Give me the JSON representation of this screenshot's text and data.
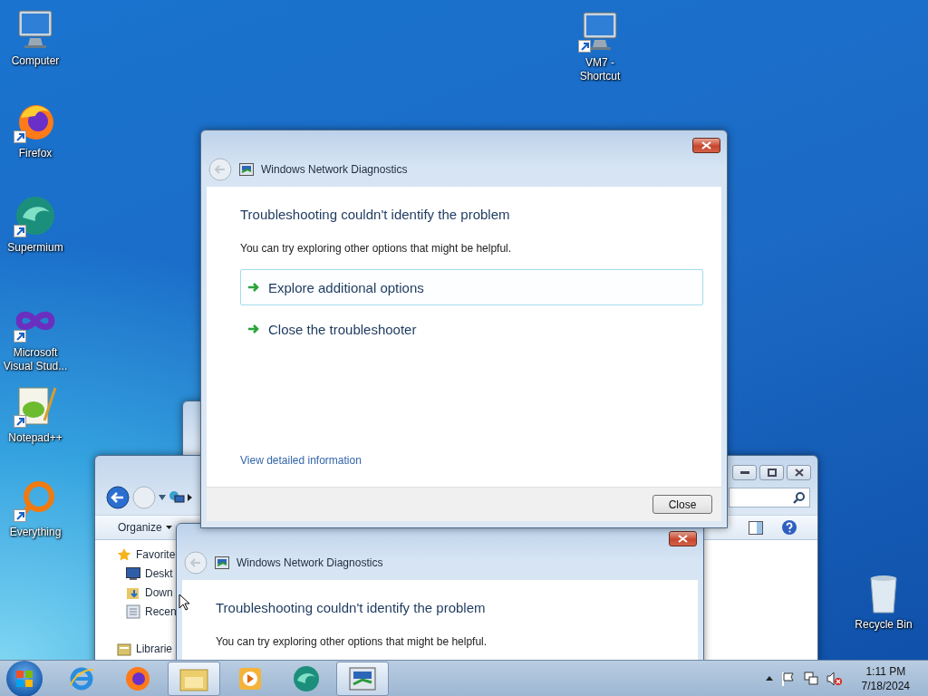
{
  "desktop_icons": [
    {
      "label": "Computer",
      "kind": "computer",
      "shortcut": false
    },
    {
      "label": "Firefox",
      "kind": "firefox",
      "shortcut": true
    },
    {
      "label": "Supermium",
      "kind": "supermium",
      "shortcut": true
    },
    {
      "label": "Microsoft Visual Stud...",
      "kind": "visualstudio",
      "shortcut": true
    },
    {
      "label": "Notepad++",
      "kind": "notepad",
      "shortcut": true
    },
    {
      "label": "Everything",
      "kind": "everything",
      "shortcut": true
    },
    {
      "label": "VM7 - Shortcut",
      "kind": "computer",
      "shortcut": true
    },
    {
      "label": "Recycle Bin",
      "kind": "recyclebin",
      "shortcut": false
    }
  ],
  "explorer": {
    "organize": "Organize",
    "nav_items": [
      {
        "label": "Favorite",
        "kind": "star"
      },
      {
        "label": "Deskt",
        "kind": "desktop"
      },
      {
        "label": "Down",
        "kind": "downloads"
      },
      {
        "label": "Recen",
        "kind": "recent"
      },
      {
        "label": "Librarie",
        "kind": "library"
      }
    ]
  },
  "dialogs": [
    {
      "title": "Windows Network Diagnostics",
      "heading": "Troubleshooting couldn't identify the problem",
      "intro": "You can try exploring other options that might be helpful.",
      "options": [
        {
          "label": "Explore additional options",
          "selected": true
        },
        {
          "label": "Close the troubleshooter",
          "selected": false
        }
      ],
      "link": "View detailed information",
      "button": "Close"
    },
    {
      "title": "Windows Network Diagnostics",
      "heading": "Troubleshooting couldn't identify the problem",
      "intro": "You can try exploring other options that might be helpful."
    }
  ],
  "taskbar": {
    "apps": [
      {
        "kind": "ie",
        "active": false
      },
      {
        "kind": "firefox",
        "active": false
      },
      {
        "kind": "explorer",
        "active": true
      },
      {
        "kind": "media",
        "active": false
      },
      {
        "kind": "supermium",
        "active": false
      },
      {
        "kind": "diagnostics",
        "active": true
      }
    ],
    "time": "1:11 PM",
    "date": "7/18/2024"
  }
}
